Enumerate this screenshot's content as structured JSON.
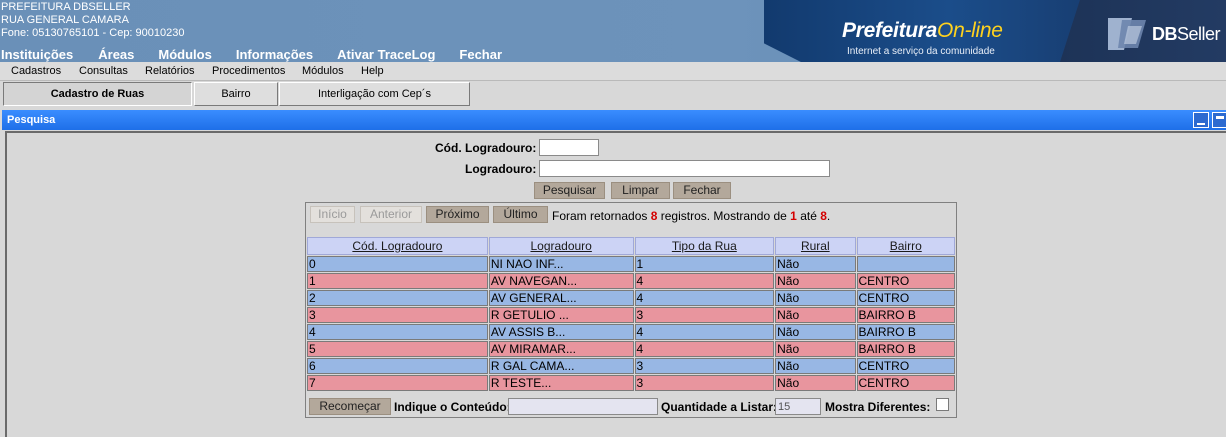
{
  "header": {
    "org_lines": [
      "PREFEITURA DBSELLER",
      "RUA GENERAL CAMARA",
      "Fone: 05130765101  -  Cep: 90010230"
    ],
    "menu": [
      "Instituições",
      "Áreas",
      "Módulos",
      "Informações",
      "Ativar TraceLog",
      "Fechar"
    ],
    "brand_main": "Prefeitura",
    "brand_highlight": "On-line",
    "brand_sub": "Internet a serviço da comunidade",
    "db_brand_bold": "DB",
    "db_brand_thin": "Seller"
  },
  "menubar": [
    "Cadastros",
    "Consultas",
    "Relatórios",
    "Procedimentos",
    "Módulos",
    "Help"
  ],
  "tabs": [
    "Cadastro de Ruas",
    "Bairro",
    "Interligação com Cep´s"
  ],
  "window": {
    "title": "Pesquisa"
  },
  "form": {
    "cod_label": "Cód. Logradouro:",
    "cod_value": "",
    "log_label": "Logradouro:",
    "log_value": "",
    "buttons": [
      "Pesquisar",
      "Limpar",
      "Fechar"
    ]
  },
  "results": {
    "nav": [
      "Início",
      "Anterior",
      "Próximo",
      "Último"
    ],
    "info_prefix": "Foram retornados",
    "total": "8",
    "info_mid": "registros. Mostrando de",
    "from": "1",
    "info_to": "até",
    "to": "8",
    "info_end": ".",
    "columns": [
      "Cód. Logradouro",
      "Logradouro",
      "Tipo da Rua",
      "Rural",
      "Bairro"
    ],
    "rows": [
      [
        "0",
        "NI NAO INF...",
        "1",
        "Não",
        ""
      ],
      [
        "1",
        "AV NAVEGAN...",
        "4",
        "Não",
        "CENTRO"
      ],
      [
        "2",
        "AV GENERAL...",
        "4",
        "Não",
        "CENTRO"
      ],
      [
        "3",
        "R GETULIO ...",
        "3",
        "Não",
        "BAIRRO B"
      ],
      [
        "4",
        "AV ASSIS B...",
        "4",
        "Não",
        "BAIRRO B"
      ],
      [
        "5",
        "AV MIRAMAR...",
        "4",
        "Não",
        "BAIRRO B"
      ],
      [
        "6",
        "R GAL CAMA...",
        "3",
        "Não",
        "CENTRO"
      ],
      [
        "7",
        "R TESTE...",
        "3",
        "Não",
        "CENTRO"
      ]
    ],
    "recomecar": "Recomeçar",
    "conteudo_label": "Indique o Conteúdo:",
    "conteudo_value": "",
    "qtd_label": "Quantidade a Listar:",
    "qtd_value": "15",
    "mostra_label": "Mostra Diferentes:",
    "mostra_checked": false
  }
}
